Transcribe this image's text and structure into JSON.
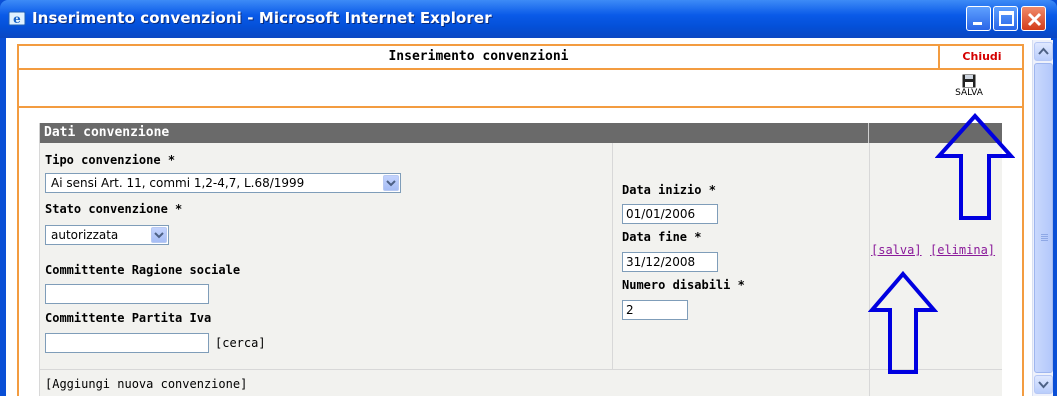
{
  "window": {
    "title": "Inserimento convenzioni - Microsoft Internet Explorer"
  },
  "page": {
    "header_title": "Inserimento convenzioni",
    "close_label": "Chiudi",
    "save_tool_label": "SALVA"
  },
  "panel": {
    "title": "Dati convenzione",
    "tipo_label": "Tipo convenzione *",
    "tipo_value": "Ai sensi Art. 11, commi 1,2-4,7, L.68/1999",
    "stato_label": "Stato convenzione *",
    "stato_value": "autorizzata",
    "ragione_label": "Committente Ragione sociale",
    "ragione_value": "",
    "piva_label": "Committente Partita Iva",
    "piva_value": "",
    "cerca_label": "[cerca]",
    "data_inizio_label": "Data inizio *",
    "data_inizio_value": "01/01/2006",
    "data_fine_label": "Data fine *",
    "data_fine_value": "31/12/2008",
    "num_disabili_label": "Numero disabili *",
    "num_disabili_value": "2",
    "salva_link": "[salva]",
    "elimina_link": "[elimina]",
    "add_label": "[Aggiungi nuova convenzione]"
  },
  "colors": {
    "orange_border": "#f39c40",
    "panel_header": "#6a6a6a",
    "close_red": "#d40000",
    "link_purple": "#8a1a9a",
    "annotation_blue": "#0000e0"
  },
  "icons": [
    "ie-icon",
    "minimize-icon",
    "maximize-icon",
    "close-icon",
    "floppy-save-icon",
    "scroll-up-icon",
    "scroll-down-icon",
    "chevron-down-icon",
    "annotation-arrow-icon"
  ]
}
